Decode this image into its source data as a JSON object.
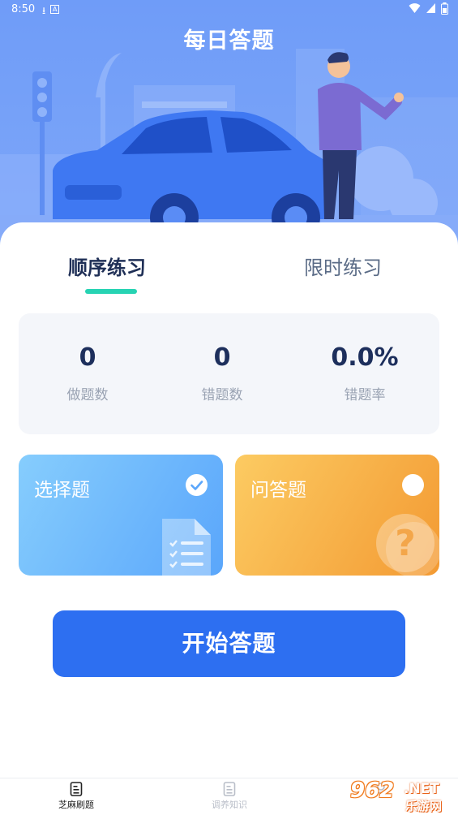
{
  "status_bar": {
    "time": "8:50",
    "left_icons": [
      "download-icon",
      "a-icon"
    ],
    "right_icons": [
      "wifi-icon",
      "signal-icon",
      "battery-icon"
    ]
  },
  "header": {
    "title": "每日答题"
  },
  "tabs": [
    {
      "label": "顺序练习",
      "active": true
    },
    {
      "label": "限时练习",
      "active": false
    }
  ],
  "stats": [
    {
      "value": "0",
      "label": "做题数"
    },
    {
      "value": "0",
      "label": "错题数"
    },
    {
      "value": "0.0%",
      "label": "错题率"
    }
  ],
  "question_types": [
    {
      "label": "选择题",
      "selected": true,
      "icon": "document-list-icon"
    },
    {
      "label": "问答题",
      "selected": false,
      "icon": "question-mark-icon"
    }
  ],
  "start_button": {
    "label": "开始答题"
  },
  "bottom_nav": [
    {
      "label": "芝麻刷题",
      "active": true,
      "icon": "document-icon"
    },
    {
      "label": "调养知识",
      "active": false,
      "icon": "document-icon"
    },
    {
      "label": "",
      "active": false,
      "icon": "profile-icon"
    }
  ],
  "watermark": {
    "big": "962",
    "net": ".NET",
    "small": "乐游网"
  },
  "colors": {
    "hero_blue": "#6f9cf8",
    "primary_button": "#2d6ff1",
    "tab_indicator": "#27d3b3",
    "choice_card": "#5aa6fb",
    "qa_card": "#f39a33",
    "stat_value": "#1d2f5c"
  }
}
